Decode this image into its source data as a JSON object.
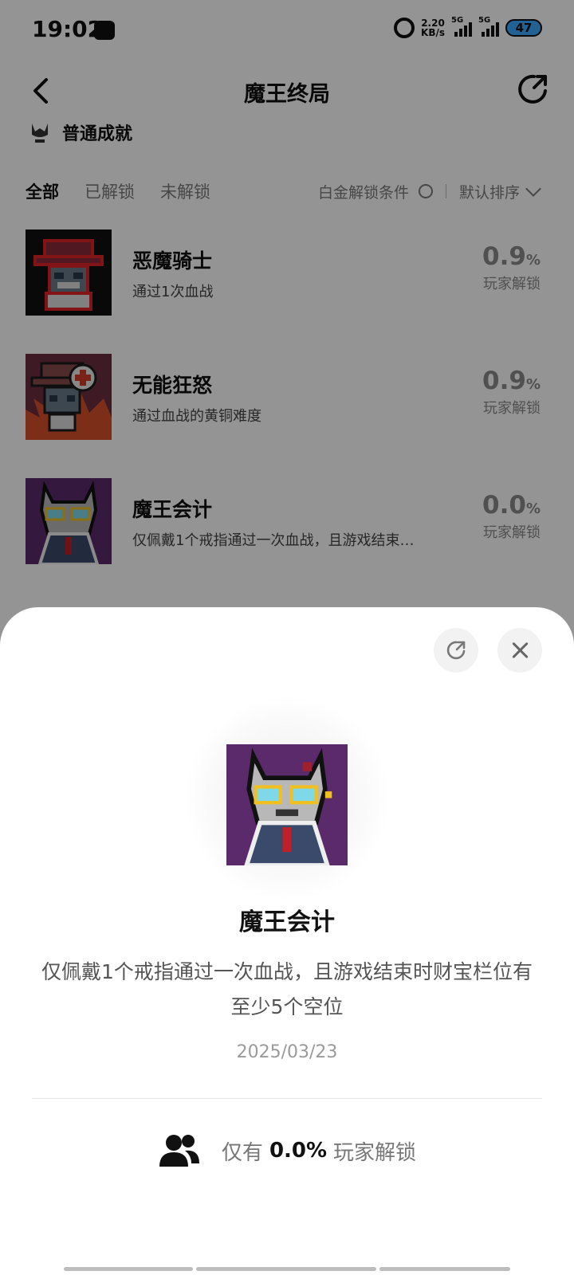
{
  "status_bar": {
    "time": "19:02",
    "net_speed_value": "2.20",
    "net_speed_unit": "KB/s",
    "signal_1": "5G",
    "signal_2": "5G",
    "battery": "47"
  },
  "header": {
    "title": "魔王终局",
    "section": "普通成就"
  },
  "filters": {
    "tabs": [
      "全部",
      "已解锁",
      "未解锁"
    ],
    "active_tab": "全部",
    "platinum_label": "白金解锁条件",
    "sort_label": "默认排序"
  },
  "achievements": [
    {
      "title": "恶魔骑士",
      "desc": "通过1次血战",
      "pct": "0.9",
      "pct_unit": "%",
      "pct_label": "玩家解锁"
    },
    {
      "title": "无能狂怒",
      "desc": "通过血战的黄铜难度",
      "pct": "0.9",
      "pct_unit": "%",
      "pct_label": "玩家解锁"
    },
    {
      "title": "魔王会计",
      "desc": "仅佩戴1个戒指通过一次血战，且游戏结束…",
      "pct": "0.0",
      "pct_unit": "%",
      "pct_label": "玩家解锁"
    }
  ],
  "detail": {
    "title": "魔王会计",
    "description": "仅佩戴1个戒指通过一次血战，且游戏结束时财宝栏位有至少5个空位",
    "date": "2025/03/23",
    "footer_prefix": "仅有",
    "footer_pct": "0.0%",
    "footer_suffix": "玩家解锁"
  },
  "colors": {
    "overlay": "rgba(0,0,0,0.42)",
    "battery": "#3aa7ff",
    "badge_bg": "#5a2a6a"
  }
}
